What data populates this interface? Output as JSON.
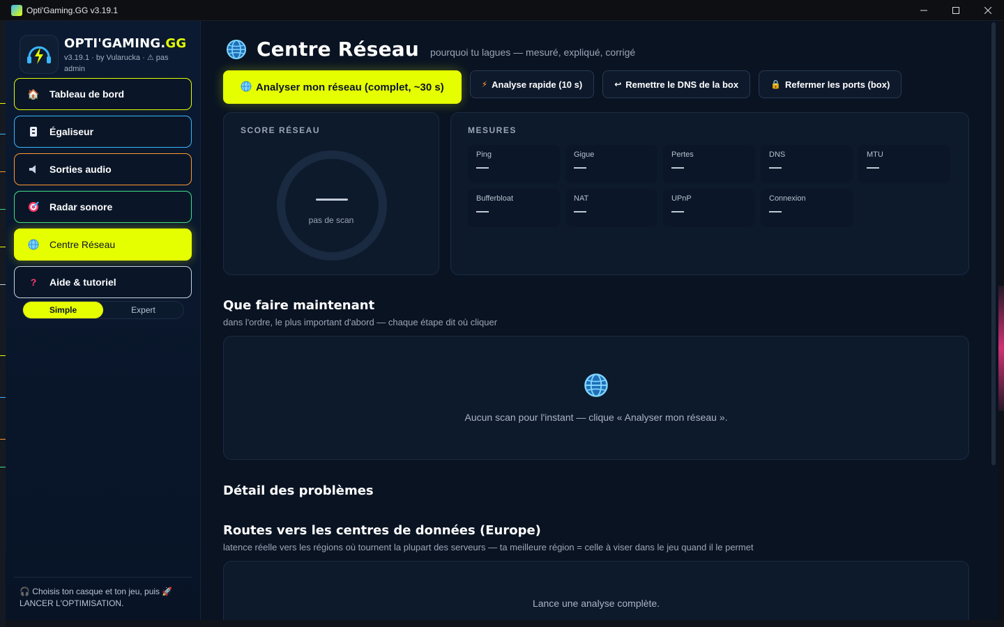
{
  "window": {
    "title": "Opti'Gaming.GG v3.19.1",
    "controls": [
      "minimize",
      "maximize",
      "close"
    ]
  },
  "sidebar": {
    "brand_main": "OPTI'GAMING.",
    "brand_accent": "GG",
    "brand_sub": "v3.19.1 · by Vularucka · ⚠ pas admin",
    "items": [
      {
        "label": "Tableau de bord",
        "icon": "house-icon",
        "color": "#e6ff00"
      },
      {
        "label": "Égaliseur",
        "icon": "equalizer-icon",
        "color": "#3ab7ff"
      },
      {
        "label": "Sorties audio",
        "icon": "speaker-icon",
        "color": "#ff9a2e"
      },
      {
        "label": "Radar sonore",
        "icon": "target-icon",
        "color": "#3fe08a"
      },
      {
        "label": "Centre Réseau",
        "icon": "globe-icon",
        "color": "#e6ff00",
        "active": true
      },
      {
        "label": "Aide & tutoriel",
        "icon": "question-icon",
        "color": "#c9d2e0"
      }
    ],
    "mode": {
      "simple": "Simple",
      "expert": "Expert",
      "selected": "Simple"
    },
    "footer": "🎧 Choisis ton casque et ton jeu, puis 🚀 LANCER L'OPTIMISATION."
  },
  "main": {
    "title": "Centre Réseau",
    "subtitle": "pourquoi tu lagues — mesuré, expliqué, corrigé",
    "actions": {
      "full": "Analyser mon réseau (complet, ~30 s)",
      "quick": "Analyse rapide (10 s)",
      "dns": "Remettre le DNS de la box",
      "ports": "Refermer les ports (box)"
    },
    "score": {
      "title": "SCORE RÉSEAU",
      "value": "",
      "label": "pas de scan"
    },
    "measures": {
      "title": "MESURES",
      "items": [
        {
          "label": "Ping",
          "value": ""
        },
        {
          "label": "Gigue",
          "value": ""
        },
        {
          "label": "Pertes",
          "value": ""
        },
        {
          "label": "DNS",
          "value": ""
        },
        {
          "label": "MTU",
          "value": ""
        },
        {
          "label": "Bufferbloat",
          "value": ""
        },
        {
          "label": "NAT",
          "value": ""
        },
        {
          "label": "UPnP",
          "value": ""
        },
        {
          "label": "Connexion",
          "value": ""
        }
      ]
    },
    "todo": {
      "title": "Que faire maintenant",
      "subtitle": "dans l'ordre, le plus important d'abord — chaque étape dit où cliquer",
      "empty": "Aucun scan pour l'instant — clique « Analyser mon réseau »."
    },
    "problems": {
      "title": "Détail des problèmes"
    },
    "routes": {
      "title": "Routes vers les centres de données (Europe)",
      "subtitle": "latence réelle vers les régions où tournent la plupart des serveurs — ta meilleure région = celle à viser dans le jeu quand il le permet",
      "empty": "Lance une analyse complète."
    }
  },
  "colors": {
    "accent": "#e6ff00",
    "background": "#091322",
    "card": "#0d1a2c"
  }
}
